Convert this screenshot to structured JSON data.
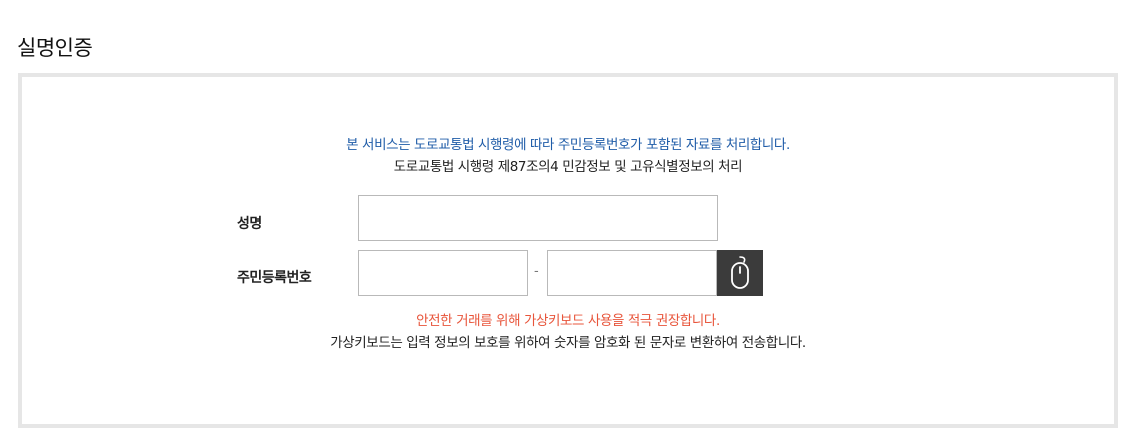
{
  "page": {
    "title": "실명인증"
  },
  "notice": {
    "line1": "본 서비스는 도로교통법 시행령에 따라 주민등록번호가 포함된 자료를 처리합니다.",
    "line2": "도로교통법 시행령 제87조의4 민감정보 및 고유식별정보의 처리"
  },
  "form": {
    "name_label": "성명",
    "name_value": "",
    "rrn_label": "주민등록번호",
    "rrn_front_value": "",
    "rrn_separator": "-",
    "rrn_back_value": "",
    "keypad_icon": "mouse-icon"
  },
  "keyboard_notice": {
    "warning": "안전한 거래를 위해 가상키보드 사용을 적극 권장합니다.",
    "description": "가상키보드는 입력 정보의 보호를 위하여 숫자를 암호화 된 문자로 변환하여 전송합니다."
  },
  "colors": {
    "notice_blue": "#1f5ca8",
    "warning_red": "#e8553b",
    "panel_border": "#e6e6e6",
    "keypad_button": "#3b3b3b"
  }
}
